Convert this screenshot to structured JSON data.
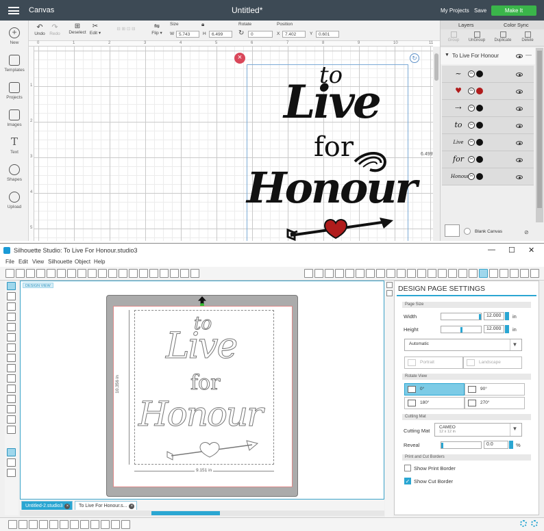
{
  "cricut": {
    "topbar": {
      "canvas_label": "Canvas",
      "doc_title": "Untitled*",
      "my_projects": "My Projects",
      "save": "Save",
      "make_it": "Make It"
    },
    "sidebar": [
      {
        "label": "New",
        "icon": "plus-icon"
      },
      {
        "label": "Templates",
        "icon": "shirt-icon"
      },
      {
        "label": "Projects",
        "icon": "projects-icon"
      },
      {
        "label": "Images",
        "icon": "image-icon"
      },
      {
        "label": "Text",
        "icon": "text-icon"
      },
      {
        "label": "Shapes",
        "icon": "shapes-icon"
      },
      {
        "label": "Upload",
        "icon": "cloud-upload-icon"
      }
    ],
    "toolbar": {
      "undo": "Undo",
      "redo": "Redo",
      "deselect": "Deselect",
      "edit": "Edit",
      "flip": "Flip",
      "size_label": "Size",
      "w_label": "W",
      "w_value": "5.743",
      "h_label": "H",
      "h_value": "6.499",
      "rotate_label": "Rotate",
      "rotate_value": "0",
      "position_label": "Position",
      "x_label": "X",
      "x_value": "7.402",
      "y_label": "Y",
      "y_value": "0.601"
    },
    "ruler_numbers": [
      "0",
      "1",
      "2",
      "3",
      "4",
      "5",
      "6",
      "7",
      "8",
      "9",
      "10",
      "11"
    ],
    "ruler_left_numbers": [
      "1",
      "2",
      "3",
      "4",
      "5"
    ],
    "height_readout": "6.499\"",
    "design_words": {
      "to": "to",
      "live": "Live",
      "for": "for",
      "honour": "Honour"
    },
    "right_panel": {
      "tab_layers": "Layers",
      "tab_color_sync": "Color Sync",
      "actions": [
        {
          "label": "Group",
          "enabled": false
        },
        {
          "label": "UnGroup",
          "enabled": true
        },
        {
          "label": "Duplicate",
          "enabled": true
        },
        {
          "label": "Delete",
          "enabled": true
        }
      ],
      "group_name": "To Live For Honour",
      "layers": [
        {
          "thumb": "~",
          "color": "#111111"
        },
        {
          "thumb": "♥",
          "color": "#b01c1c",
          "thumb_color": "#b01c1c"
        },
        {
          "thumb": "⇢",
          "color": "#111111"
        },
        {
          "thumb": "to",
          "color": "#111111"
        },
        {
          "thumb": "Live",
          "color": "#111111"
        },
        {
          "thumb": "for",
          "color": "#111111"
        },
        {
          "thumb": "Honour",
          "color": "#111111"
        }
      ],
      "blank_canvas": "Blank Canvas"
    },
    "colors": {
      "topbar": "#3d4a55",
      "make_it": "#3ab54a",
      "heart": "#b01c1c"
    }
  },
  "silhouette": {
    "window_title": "Silhouette Studio: To Live For Honour.studio3",
    "menu": [
      "File",
      "Edit",
      "View",
      "Silhouette",
      "Object",
      "Help"
    ],
    "design_view": "DESIGN VIEW",
    "width_dim": "9.151 in",
    "height_dim": "10.356 in",
    "tabs": [
      {
        "label": "Untitled-2.studio3",
        "active": true
      },
      {
        "label": "To Live For Honour.s...",
        "active": false
      }
    ],
    "panel": {
      "title": "DESIGN PAGE SETTINGS",
      "page_size_section": "Page Size",
      "width_label": "Width",
      "width_value": "12.000",
      "height_label": "Height",
      "height_value": "12.000",
      "unit": "in",
      "page_preset": "Automatic",
      "portrait": "Portrait",
      "landscape": "Landscape",
      "rotate_section": "Rotate View",
      "rotations": [
        "0°",
        "90°",
        "180°",
        "270°"
      ],
      "selected_rotation": "0°",
      "cutting_mat_section": "Cutting Mat",
      "cutting_mat_label": "Cutting Mat",
      "cutting_mat_value": "CAMEO",
      "cutting_mat_sub": "12 x 12 in",
      "reveal_label": "Reveal",
      "reveal_value": "0.0",
      "reveal_unit": "%",
      "borders_section": "Print and Cut Borders",
      "show_print_border": "Show Print Border",
      "show_print_border_checked": false,
      "show_cut_border": "Show Cut Border",
      "show_cut_border_checked": true
    },
    "colors": {
      "accent": "#2aa6d2"
    }
  }
}
